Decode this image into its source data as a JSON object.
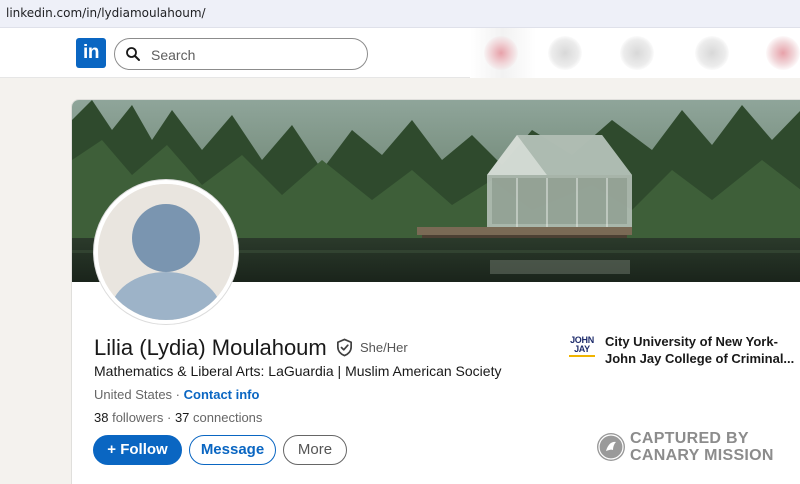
{
  "browser": {
    "url": "linkedin.com/in/lydiamoulahoum/"
  },
  "nav": {
    "logo_text": "in",
    "search_placeholder": "Search"
  },
  "profile": {
    "name": "Lilia (Lydia) Moulahoum",
    "pronouns": "She/Her",
    "headline": "Mathematics & Liberal Arts: LaGuardia | Muslim American Society",
    "location": "United States",
    "location_separator": " · ",
    "contact_info": "Contact info",
    "followers_count": "38",
    "followers_label": " followers",
    "stats_separator": " · ",
    "connections_count": "37",
    "connections_label": " connections"
  },
  "actions": {
    "follow": "+ Follow",
    "message": "Message",
    "more": "More"
  },
  "education": {
    "logo_line1": "JOHN",
    "logo_line2": "JAY",
    "line1": "City University of New York-",
    "line2": "John Jay College of Criminal..."
  },
  "watermark": {
    "line1": "CAPTURED BY",
    "line2": "CANARY MISSION"
  },
  "colors": {
    "accent": "#0a66c2",
    "background": "#f4f2ee"
  },
  "icons": {
    "search": "search-icon",
    "verify": "verified-shield-icon"
  }
}
